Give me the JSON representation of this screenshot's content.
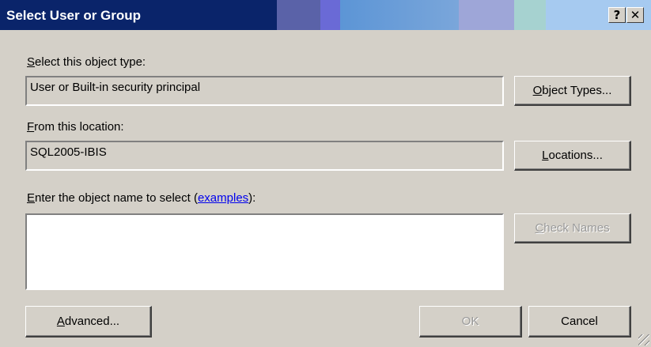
{
  "window": {
    "title": "Select User or Group",
    "help_glyph": "?",
    "close_glyph": "✕"
  },
  "object_type": {
    "label_accel": "S",
    "label_rest": "elect this object type:",
    "value": "User or Built-in security principal",
    "button_accel": "O",
    "button_rest": "bject Types..."
  },
  "location": {
    "label_accel": "F",
    "label_rest": "rom this location:",
    "value": "SQL2005-IBIS",
    "button_accel": "L",
    "button_rest": "ocations..."
  },
  "object_name": {
    "label_accel": "E",
    "label_rest": "nter the object name to select (",
    "link": "examples",
    "label_end": "):",
    "value": "",
    "check_accel": "C",
    "check_rest": "heck Names"
  },
  "footer": {
    "advanced_accel": "A",
    "advanced_rest": "dvanced...",
    "ok": "OK",
    "cancel": "Cancel"
  }
}
